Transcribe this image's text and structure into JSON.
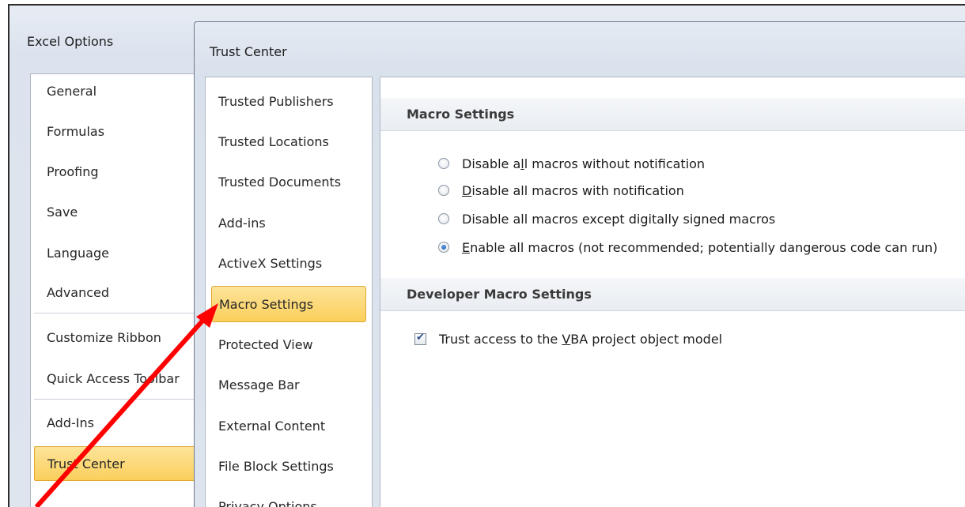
{
  "excel_options": {
    "title": "Excel Options",
    "nav": [
      {
        "label": "General"
      },
      {
        "label": "Formulas"
      },
      {
        "label": "Proofing"
      },
      {
        "label": "Save"
      },
      {
        "label": "Language"
      },
      {
        "label": "Advanced"
      },
      {
        "label": "Customize Ribbon"
      },
      {
        "label": "Quick Access Toolbar"
      },
      {
        "label": "Add-Ins"
      },
      {
        "label": "Trust Center"
      }
    ],
    "selected": "Trust Center"
  },
  "trust_center": {
    "title": "Trust Center",
    "nav": [
      {
        "label": "Trusted Publishers"
      },
      {
        "label": "Trusted Locations"
      },
      {
        "label": "Trusted Documents"
      },
      {
        "label": "Add-ins"
      },
      {
        "label": "ActiveX Settings"
      },
      {
        "label": "Macro Settings"
      },
      {
        "label": "Protected View"
      },
      {
        "label": "Message Bar"
      },
      {
        "label": "External Content"
      },
      {
        "label": "File Block Settings"
      },
      {
        "label": "Privacy Options"
      }
    ],
    "selected": "Macro Settings"
  },
  "macro_settings": {
    "header": "Macro Settings",
    "options": [
      {
        "pre": "Disable a",
        "ul": "l",
        "post": "l macros without notification",
        "checked": false
      },
      {
        "pre": "",
        "ul": "D",
        "post": "isable all macros with notification",
        "checked": false
      },
      {
        "pre": "Disable all macros except di",
        "ul": "g",
        "post": "itally signed macros",
        "checked": false
      },
      {
        "pre": "",
        "ul": "E",
        "post": "nable all macros (not recommended; potentially dangerous code can run)",
        "checked": true
      }
    ]
  },
  "developer_macro_settings": {
    "header": "Developer Macro Settings",
    "trust_vba": {
      "pre": "Trust access to the ",
      "ul": "V",
      "post": "BA project object model",
      "checked": true
    }
  },
  "colors": {
    "selected_highlight": "#fbcf5b",
    "annotation_arrow": "#ff0000"
  }
}
